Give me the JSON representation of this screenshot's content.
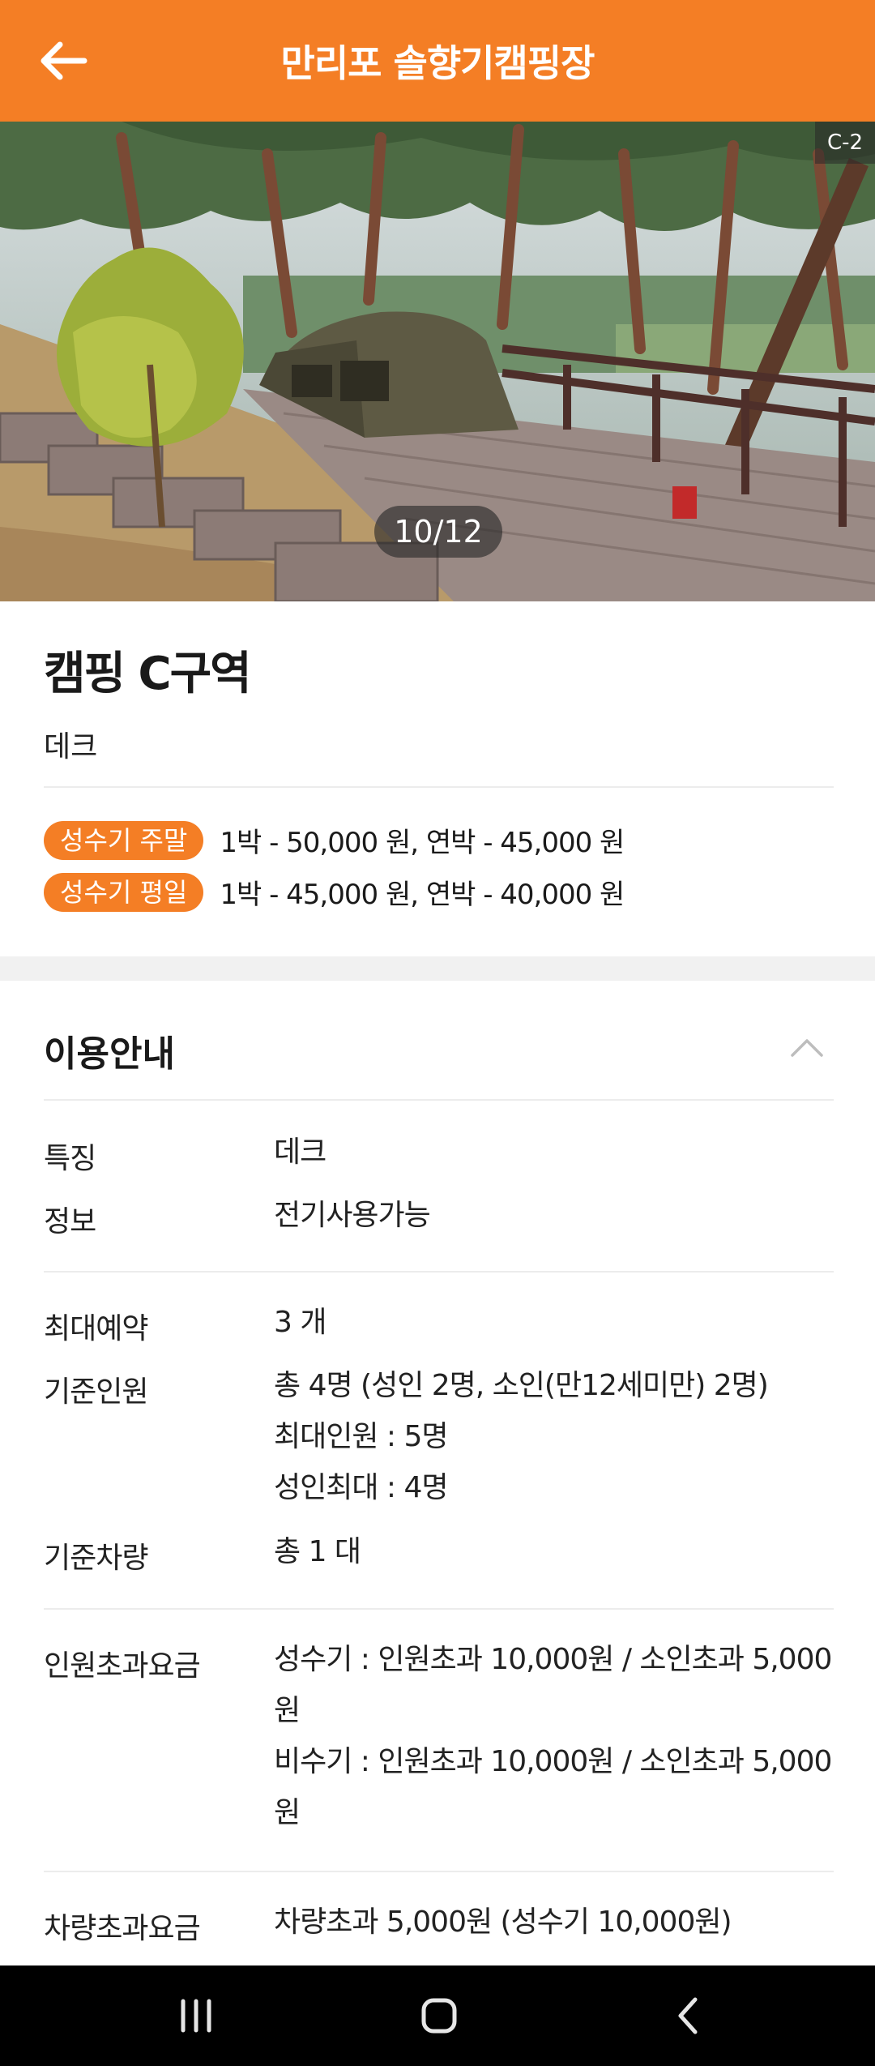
{
  "header": {
    "title": "만리포 솔향기캠핑장",
    "back_icon": "arrow-left-icon"
  },
  "gallery": {
    "counter": "10/12",
    "corner_tag": "C-2"
  },
  "site": {
    "name": "캠핑 C구역",
    "type": "데크",
    "prices": [
      {
        "badge": "성수기 주말",
        "text": "1박 - 50,000 원, 연박 - 45,000 원"
      },
      {
        "badge": "성수기 평일",
        "text": "1박 - 45,000 원, 연박 - 40,000 원"
      }
    ]
  },
  "info": {
    "title": "이용안내",
    "rows": {
      "feature": {
        "label": "특징",
        "value": "데크"
      },
      "detail": {
        "label": "정보",
        "value": "전기사용가능"
      },
      "max_booking": {
        "label": "최대예약",
        "value": "3 개"
      },
      "base_people": {
        "label": "기준인원",
        "lines": [
          "총 4명 (성인 2명, 소인(만12세미만) 2명)",
          "최대인원 : 5명",
          "성인최대 : 4명"
        ]
      },
      "base_cars": {
        "label": "기준차량",
        "value": "총 1 대"
      },
      "extra_person_fee": {
        "label": "인원초과요금",
        "lines": [
          "성수기 : 인원초과 10,000원 / 소인초과 5,000",
          "원",
          "비수기 : 인원초과 10,000원 / 소인초과 5,000",
          "원"
        ]
      },
      "extra_car_fee": {
        "label": "차량초과요금",
        "value": "차량초과 5,000원 (성수기 10,000원)"
      }
    }
  },
  "colors": {
    "accent": "#f47e25",
    "divider": "#ececec",
    "section_gap": "#f1f1f1"
  },
  "system_nav": {
    "recent": "recent-apps-icon",
    "home": "home-icon",
    "back": "back-chevron-icon"
  }
}
